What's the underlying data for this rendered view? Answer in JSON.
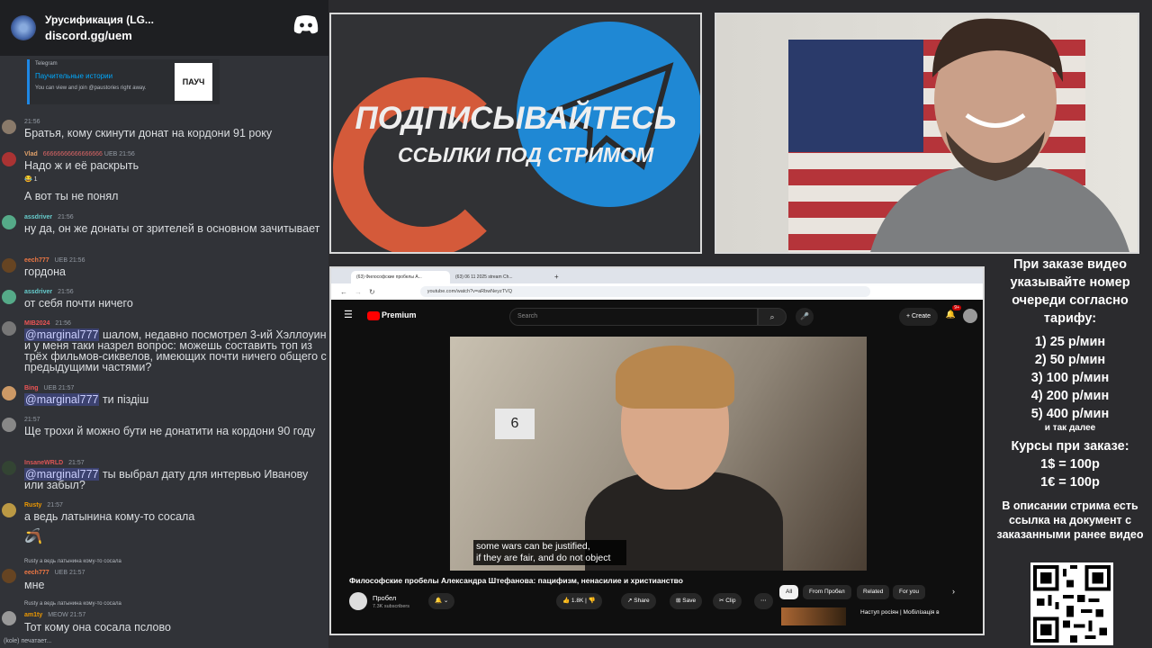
{
  "discord": {
    "server_name": "Урусификация (LG...",
    "invite": "discord.gg/uem",
    "embed": {
      "source": "Telegram",
      "title": "Паучительные истории",
      "desc": "You can view and join @paustories right away.",
      "thumb_label": "ПАУЧ"
    },
    "messages": [
      {
        "name": "",
        "time": "21:56",
        "text": "Братья, кому скинути донат на кордони 91 року"
      },
      {
        "name": "Vlad",
        "extra": "66666666666666666",
        "badge": "UEB",
        "time": "21:56",
        "text": "Надо ж и её раскрыть",
        "reaction": "1"
      },
      {
        "text": "А вот ты не понял"
      },
      {
        "name": "assdriver",
        "time": "21:56",
        "text": "ну да, он же донаты от зрителей в основном зачитывает"
      },
      {
        "name": "eech777",
        "badge": "UEB",
        "time": "21:56",
        "text": "гордона"
      },
      {
        "name": "assdriver",
        "time": "21:56",
        "text": "от себя почти ничего"
      },
      {
        "name": "MIB2024",
        "time": "21:56",
        "mention": "@marginal777",
        "text": " шалом, недавно посмотрел 3-ий Хэллоуин и у меня таки назрел вопрос: можешь составить топ из трёх фильмов-сиквелов, имеющих почти ничего общего с предыдущими частями?"
      },
      {
        "name": "Bing",
        "badge": "UEB",
        "time": "21:57",
        "mention": "@marginal777",
        "text": " ти піздіш"
      },
      {
        "name": "",
        "time": "21:57",
        "text": "Ще трохи й можно бути не донатити на кордони 90 году"
      },
      {
        "name": "InsaneWRLD",
        "time": "21:57",
        "mention": "@marginal777",
        "text": " ты выбрал дату для интервью Иванову или забыл?"
      },
      {
        "name": "Rusty",
        "time": "21:57",
        "text": "а ведь латынина кому-то сосала"
      },
      {
        "reply": "Rusty а ведь латынина кому-то сосала",
        "name": "eech777",
        "badge": "UEB",
        "time": "21:57",
        "text": "мне"
      },
      {
        "reply": "Rusty а ведь латынина кому-то сосала",
        "name": "am1ty",
        "badge": "MEOW",
        "time": "21:57",
        "text": "Тот кому она сосала пслово"
      }
    ],
    "typing": "(kole) печатает..."
  },
  "promo": {
    "headline": "ПОДПИСЫВАЙТЕСЬ",
    "subline": "ССЫЛКИ ПОД СТРИМОМ"
  },
  "browser": {
    "tabs": [
      "(63) Философские пробелы А...",
      "(63) 06 11 2025 stream Ch..."
    ],
    "url": "youtube.com/watch?v=aRbwNeyzTVQ",
    "youtube": {
      "logo": "Premium",
      "search_placeholder": "Search",
      "create_label": "Create",
      "notif_count": "9+",
      "subtitle_line1": "some wars can be justified,",
      "subtitle_line2": "if they are fair, and do not object",
      "calendar_day": "6",
      "video_title": "Философские пробелы Александра Штефанова: пацифизм, ненасилие и христианство",
      "channel": "Пробел",
      "subscribers": "7.3K subscribers",
      "likes": "1.8K",
      "share": "Share",
      "save": "Save",
      "clip": "Clip",
      "chips": [
        "All",
        "From Пробел",
        "Related",
        "For you"
      ],
      "rec_title": "Наступ росіян | Мобілізація в"
    }
  },
  "info": {
    "order_text": "При заказе видео указывайте номер очереди согласно тарифу:",
    "tariffs": [
      "1) 25 р/мин",
      "2) 50 р/мин",
      "3) 100 р/мин",
      "4) 200 р/мин",
      "5) 400 р/мин"
    ],
    "etc": "и так далее",
    "rates_title": "Курсы при заказе:",
    "rates": [
      "1$ = 100р",
      "1€ = 100р"
    ],
    "desc_text": "В описании стрима есть ссылка на документ с заказанными ранее видео"
  }
}
